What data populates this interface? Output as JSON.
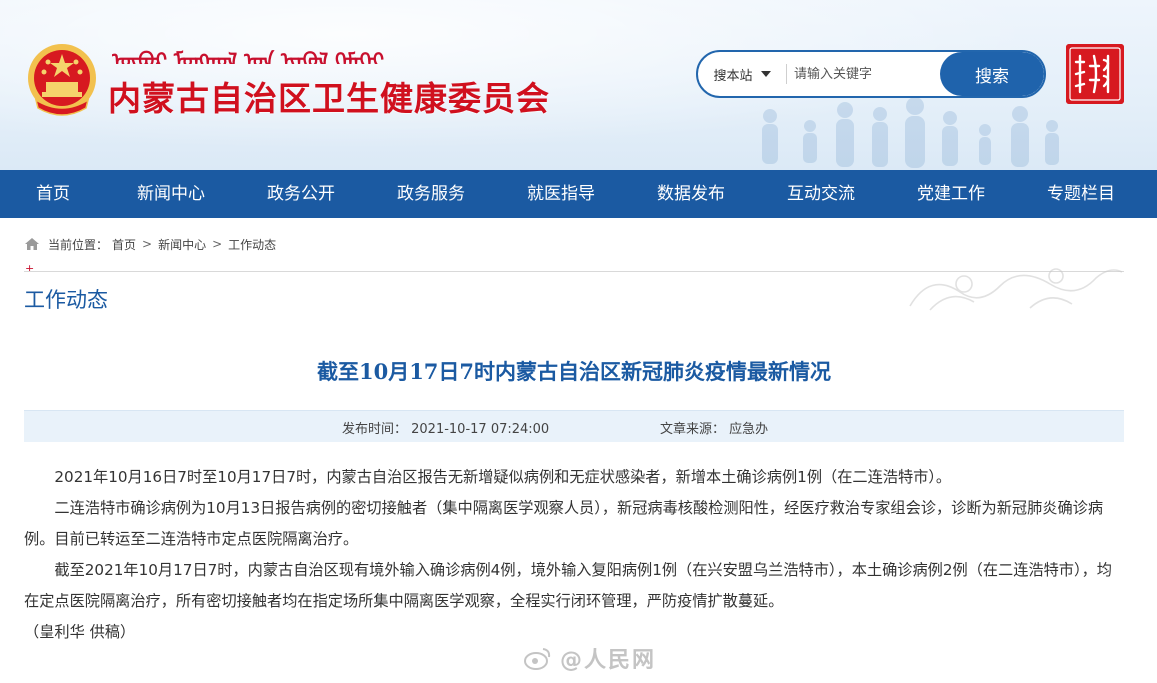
{
  "header": {
    "site_title": "内蒙古自治区卫生健康委员会",
    "mongol_script": "ᠥᠪᠥᠷ ᠮᠣᠩᠭᠣᠯ ᠤᠨ ᠡᠷᠡᠭᠦᠯ ᠬᠡᠮᠡᠬᠡᠢ"
  },
  "search": {
    "scope_label": "搜本站",
    "placeholder": "请输入关键字",
    "button_label": "搜索"
  },
  "nav": {
    "items": [
      "首页",
      "新闻中心",
      "政务公开",
      "政务服务",
      "就医指导",
      "数据发布",
      "互动交流",
      "党建工作",
      "专题栏目"
    ]
  },
  "breadcrumb": {
    "prefix": "当前位置：",
    "items": [
      "首页",
      "新闻中心",
      "工作动态"
    ],
    "separator": ">"
  },
  "section": {
    "title": "工作动态"
  },
  "article": {
    "title": "截至10月17日7时内蒙古自治区新冠肺炎疫情最新情况",
    "publish_time": "发布时间： 2021-10-17 07:24:00",
    "source": "文章来源： 应急办",
    "paragraphs": [
      "2021年10月16日7时至10月17日7时，内蒙古自治区报告无新增疑似病例和无症状感染者，新增本土确诊病例1例（在二连浩特市）。",
      "二连浩特市确诊病例为10月13日报告病例的密切接触者（集中隔离医学观察人员），新冠病毒核酸检测阳性，经医疗救治专家组会诊，诊断为新冠肺炎确诊病例。目前已转运至二连浩特市定点医院隔离治疗。",
      "截至2021年10月17日7时，内蒙古自治区现有境外输入确诊病例4例，境外输入复阳病例1例（在兴安盟乌兰浩特市），本土确诊病例2例（在二连浩特市），均在定点医院隔离治疗，所有密切接触者均在指定场所集中隔离医学观察，全程实行闭环管理，严防疫情扩散蔓延。"
    ],
    "credit": "（皇利华  供稿）"
  },
  "watermark": {
    "text": "@人民网"
  },
  "colors": {
    "brand_red": "#d0101e",
    "nav_blue": "#1b5aa2",
    "search_blue": "#1f63ac",
    "meta_bg": "#e9f2fa"
  },
  "icons": {
    "emblem": "national-emblem-icon",
    "home": "home-icon",
    "caret": "caret-down-icon",
    "logo": "mongolian-script-logo-icon",
    "watermark": "weibo-icon"
  }
}
